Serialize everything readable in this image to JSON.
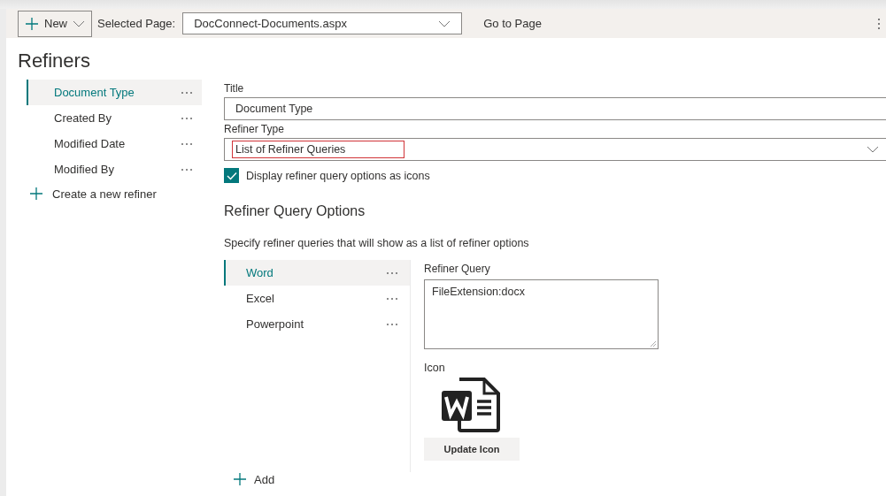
{
  "toolbar": {
    "new_button": "New",
    "selected_page_label": "Selected Page:",
    "selected_page": "DocConnect-Documents.aspx",
    "go_button": "Go to Page"
  },
  "page_title": "Refiners",
  "refiners": [
    {
      "label": "Document Type",
      "selected": true
    },
    {
      "label": "Created By",
      "selected": false
    },
    {
      "label": "Modified Date",
      "selected": false
    },
    {
      "label": "Modified By",
      "selected": false
    }
  ],
  "create_refiner": "Create a new refiner",
  "form": {
    "title_label": "Title",
    "title_value": "Document Type",
    "type_label": "Refiner Type",
    "type_value": "List of Refiner Queries",
    "type_highlighted": true,
    "icons_checkbox": {
      "label": "Display refiner query options as icons",
      "checked": true
    }
  },
  "query_options": {
    "heading": "Refiner Query Options",
    "description": "Specify refiner queries that will show as a list of refiner options",
    "items": [
      {
        "label": "Word",
        "selected": true
      },
      {
        "label": "Excel",
        "selected": false
      },
      {
        "label": "Powerpoint",
        "selected": false
      }
    ],
    "query_label": "Refiner Query",
    "query_value": "FileExtension:docx",
    "icon_label": "Icon",
    "update_button": "Update Icon",
    "add_button": "Add"
  }
}
